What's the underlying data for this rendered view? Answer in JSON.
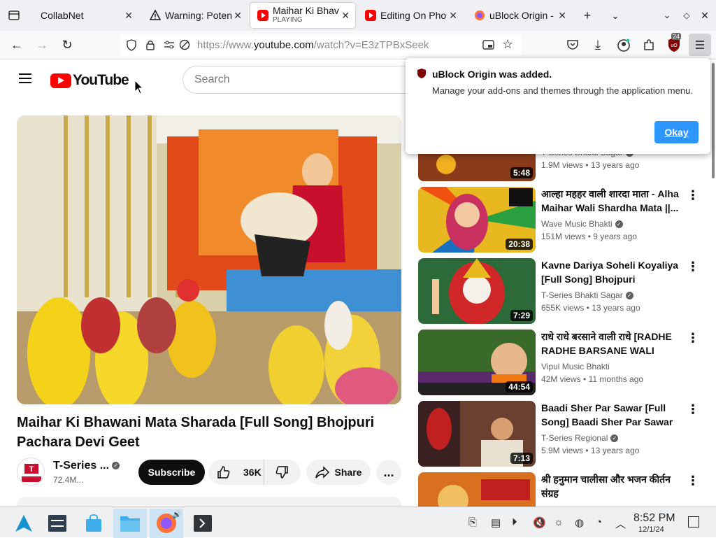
{
  "browser": {
    "tabs": [
      {
        "title": "CollabNet"
      },
      {
        "title": "Warning: Poten"
      },
      {
        "title": "Maihar Ki Bhav",
        "subtitle": "PLAYING"
      },
      {
        "title": "Editing On Pho"
      },
      {
        "title": "uBlock Origin -"
      }
    ],
    "url_prefix": "https://www.",
    "url_domain": "youtube.com",
    "url_rest": "/watch?v=E3zTPBxSeek",
    "ublock_badge": "24"
  },
  "youtube": {
    "logo_text": "YouTube",
    "search_placeholder": "Search",
    "video_title": "Maihar Ki Bhawani Mata Sharada [Full Song] Bhojpuri Pachara Devi Geet",
    "channel_name": "T-Series ...",
    "subscribers": "72.4M...",
    "subscribe_label": "Subscribe",
    "like_count": "36K",
    "share_label": "Share",
    "more_label": "..."
  },
  "recommendations": [
    {
      "title": "",
      "channel": "T-Series Bhakti Sagar",
      "views": "1.9M views",
      "age": "13 years ago",
      "duration": "5:48"
    },
    {
      "title": "आल्हा महहर वाली शारदा माता - Alha Maihar Wali Shardha Mata ||...",
      "channel": "Wave Music Bhakti",
      "views": "151M views",
      "age": "9 years ago",
      "duration": "20:38"
    },
    {
      "title": "Kavne Dariya Soheli Koyaliya [Full Song] Bhojpuri Pachara...",
      "channel": "T-Series Bhakti Sagar",
      "views": "655K views",
      "age": "13 years ago",
      "duration": "7:29"
    },
    {
      "title": "राधे राधे बरसाने वाली राधे [RADHE RADHE BARSANE WALI RADH...",
      "channel": "Vipul Music Bhakti",
      "views": "42M views",
      "age": "11 months ago",
      "duration": "44:54"
    },
    {
      "title": "Baadi Sher Par Sawar [Full Song] Baadi Sher Par Sawar",
      "channel": "T-Series Regional",
      "views": "5.9M views",
      "age": "13 years ago",
      "duration": "7:13"
    },
    {
      "title": "श्री हनुमान चालीसा और भजन कीर्तन संग्रह",
      "channel": "",
      "views": "",
      "age": "",
      "duration": ""
    }
  ],
  "notification": {
    "title": "uBlock Origin was added.",
    "body": "Manage your add-ons and themes through the application menu.",
    "button": "Okay"
  },
  "taskbar": {
    "time": "8:52 PM",
    "date": "12/1/24"
  },
  "colors": {
    "yt_red": "#ff0000",
    "okay_button": "#0a84ff",
    "ublock_red": "#800000"
  }
}
